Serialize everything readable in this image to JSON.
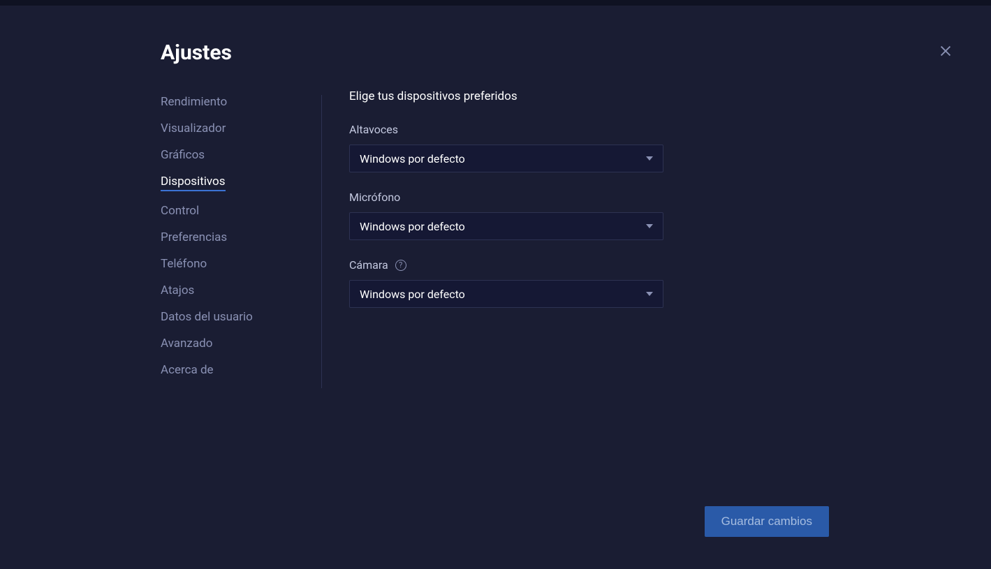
{
  "page_title": "Ajustes",
  "sidebar": {
    "items": [
      {
        "label": "Rendimiento",
        "active": false
      },
      {
        "label": "Visualizador",
        "active": false
      },
      {
        "label": "Gráficos",
        "active": false
      },
      {
        "label": "Dispositivos",
        "active": true
      },
      {
        "label": "Control",
        "active": false
      },
      {
        "label": "Preferencias",
        "active": false
      },
      {
        "label": "Teléfono",
        "active": false
      },
      {
        "label": "Atajos",
        "active": false
      },
      {
        "label": "Datos del usuario",
        "active": false
      },
      {
        "label": "Avanzado",
        "active": false
      },
      {
        "label": "Acerca de",
        "active": false
      }
    ]
  },
  "main": {
    "section_title": "Elige tus dispositivos preferidos",
    "speakers": {
      "label": "Altavoces",
      "value": "Windows por defecto"
    },
    "microphone": {
      "label": "Micrófono",
      "value": "Windows por defecto"
    },
    "camera": {
      "label": "Cámara",
      "value": "Windows por defecto"
    }
  },
  "footer": {
    "save_label": "Guardar cambios"
  }
}
